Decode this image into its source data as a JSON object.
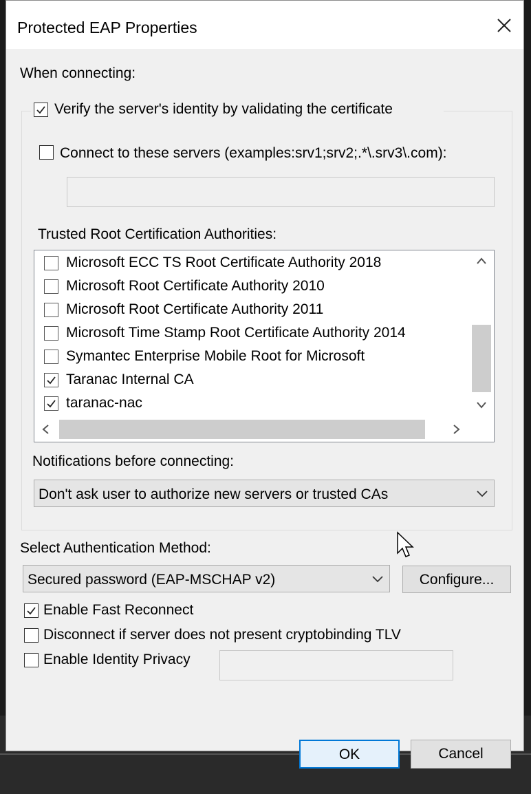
{
  "dialog": {
    "title": "Protected EAP Properties"
  },
  "when_connecting": "When connecting:",
  "verify_server": {
    "label": "Verify the server's identity by validating the certificate",
    "checked": true
  },
  "connect_servers": {
    "label": "Connect to these servers (examples:srv1;srv2;.*\\.srv3\\.com):",
    "checked": false,
    "value": ""
  },
  "trusted_root": {
    "label": "Trusted Root Certification Authorities:",
    "items": [
      {
        "label": "Microsoft ECC TS Root Certificate Authority 2018",
        "checked": false
      },
      {
        "label": "Microsoft Root Certificate Authority 2010",
        "checked": false
      },
      {
        "label": "Microsoft Root Certificate Authority 2011",
        "checked": false
      },
      {
        "label": "Microsoft Time Stamp Root Certificate Authority 2014",
        "checked": false
      },
      {
        "label": "Symantec Enterprise Mobile Root for Microsoft",
        "checked": false
      },
      {
        "label": "Taranac Internal CA",
        "checked": true
      },
      {
        "label": "taranac-nac",
        "checked": true
      }
    ]
  },
  "notifications": {
    "label": "Notifications before connecting:",
    "selected": "Don't ask user to authorize new servers or trusted CAs"
  },
  "auth_method": {
    "label": "Select Authentication Method:",
    "selected": "Secured password (EAP-MSCHAP v2)",
    "configure_label": "Configure..."
  },
  "fast_reconnect": {
    "label": "Enable Fast Reconnect",
    "checked": true
  },
  "cryptobinding": {
    "label": "Disconnect if server does not present cryptobinding TLV",
    "checked": false
  },
  "identity_privacy": {
    "label": "Enable Identity Privacy",
    "checked": false,
    "value": ""
  },
  "buttons": {
    "ok": "OK",
    "cancel": "Cancel"
  },
  "colors": {
    "accent": "#0078d7",
    "dialog_bg": "#f0f0f0"
  }
}
